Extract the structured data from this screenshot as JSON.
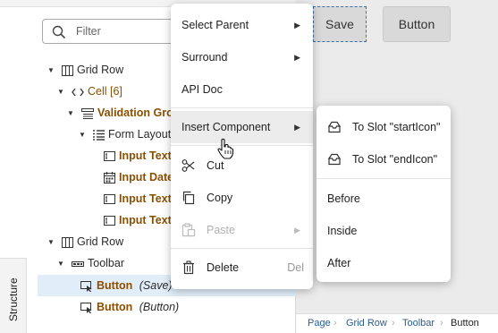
{
  "filter": {
    "placeholder": "Filter"
  },
  "tree": {
    "rows": [
      {
        "name": "Grid Row",
        "extra": ""
      },
      {
        "name": "Cell [6]",
        "extra": ""
      },
      {
        "name": "Validation Gro",
        "extra": ""
      },
      {
        "name": "Form Layout",
        "extra": ""
      },
      {
        "name": "Input Text",
        "extra": ""
      },
      {
        "name": "Input Date",
        "extra": ""
      },
      {
        "name": "Input Text",
        "extra": ""
      },
      {
        "name": "Input Text",
        "extra": ""
      },
      {
        "name": "Grid Row",
        "extra": ""
      },
      {
        "name": "Toolbar",
        "extra": ""
      },
      {
        "name": "Button",
        "extra": "(Save)"
      },
      {
        "name": "Button",
        "extra": "(Button)"
      }
    ]
  },
  "side_tab": {
    "label": "Structure"
  },
  "canvas": {
    "save_label": "Save",
    "button_label": "Button"
  },
  "breadcrumb": [
    "Page",
    "Grid Row",
    "Toolbar",
    "Button"
  ],
  "context_menu": {
    "select_parent": "Select Parent",
    "surround": "Surround",
    "api_doc": "API Doc",
    "insert_component": "Insert Component",
    "cut": "Cut",
    "copy": "Copy",
    "paste": "Paste",
    "delete": "Delete",
    "delete_shortcut": "Del"
  },
  "submenu": {
    "to_slot_start": "To Slot \"startIcon\"",
    "to_slot_end": "To Slot \"endIcon\"",
    "before": "Before",
    "inside": "Inside",
    "after": "After"
  },
  "colors": {
    "component_text": "#8a4f00",
    "selection": "#e1eef9",
    "link": "#2a5d8c"
  }
}
